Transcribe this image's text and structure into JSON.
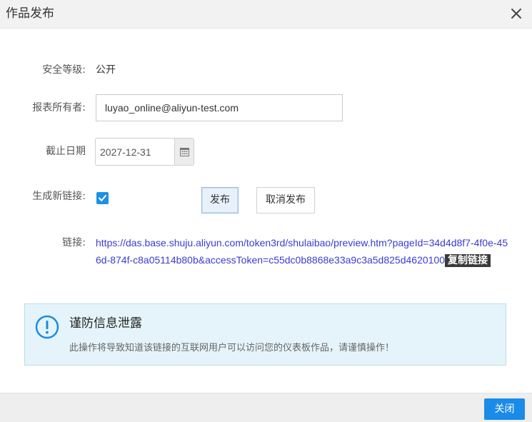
{
  "dialog": {
    "title": "作品发布",
    "close_icon": "close-icon"
  },
  "form": {
    "security_label": "安全等级:",
    "security_value": "公开",
    "owner_label": "报表所有者:",
    "owner_value": "luyao_online@aliyun-test.com",
    "deadline_label": "截止日期",
    "deadline_value": "2027-12-31",
    "calendar_icon": "calendar-icon",
    "new_link_label": "生成新链接:",
    "new_link_checked": true,
    "publish_button": "发布",
    "unpublish_button": "取消发布",
    "link_label": "链接:",
    "link_url": "https://das.base.shuju.aliyun.com/token3rd/shulaibao/preview.htm?pageId=34d4d8f7-4f0e-456d-874f-c8a05114b80b&accessToken=c55dc0b8868e33a9c3a5d825d4620100",
    "copy_link": "复制链接"
  },
  "alert": {
    "icon": "exclamation-circle-icon",
    "title": "谨防信息泄露",
    "text": "此操作将导致知道该链接的互联网用户可以访问您的仪表板作品，请谨慎操作！",
    "color": "#1a8be8"
  },
  "footer": {
    "close_button": "关闭",
    "accent": "#1a8be8"
  }
}
